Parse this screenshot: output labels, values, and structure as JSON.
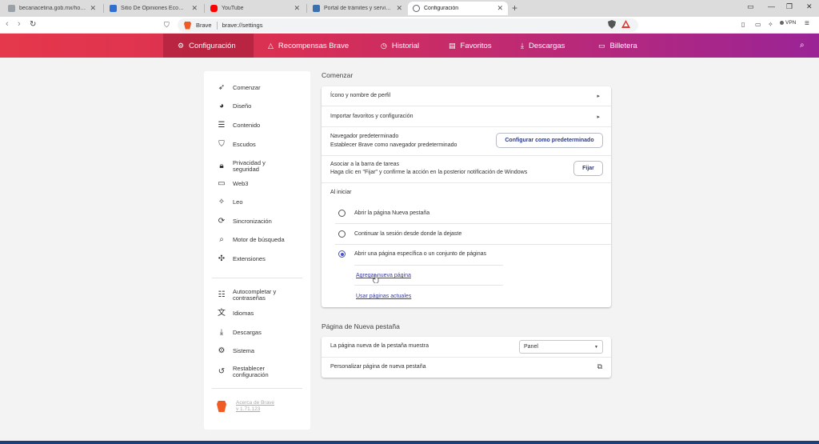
{
  "tabs": [
    {
      "title": "becariacetina.gob.mx/home.shtml",
      "favicon_color": "#9aa0a6",
      "active": false
    },
    {
      "title": "Sitio De Opiniones Ecommerce: Tu",
      "favicon_color": "#2f6fd1",
      "active": false
    },
    {
      "title": "YouTube",
      "favicon_color": "#ff0000",
      "active": false
    },
    {
      "title": "Portal de trámites y servicios - SAT",
      "favicon_color": "#3a6fb0",
      "active": false
    },
    {
      "title": "Configuración",
      "favicon_color": "#5f6368",
      "active": true
    }
  ],
  "new_tab_icon": "plus-icon",
  "address_bar": {
    "brave_label": "Brave",
    "url": "brave://settings"
  },
  "vpn_label": "VPN",
  "header_nav": [
    {
      "label": "Configuración",
      "icon": "gear-icon",
      "active": true
    },
    {
      "label": "Recompensas Brave",
      "icon": "triangle-icon",
      "active": false
    },
    {
      "label": "Historial",
      "icon": "history-icon",
      "active": false
    },
    {
      "label": "Favoritos",
      "icon": "bookmarks-icon",
      "active": false
    },
    {
      "label": "Descargas",
      "icon": "download-icon",
      "active": false
    },
    {
      "label": "Billetera",
      "icon": "wallet-icon",
      "active": false
    }
  ],
  "sidebar": {
    "items": [
      {
        "label": "Comenzar",
        "icon": "rocket-icon"
      },
      {
        "label": "Diseño",
        "icon": "palette-icon"
      },
      {
        "label": "Contenido",
        "icon": "content-icon"
      },
      {
        "label": "Escudos",
        "icon": "shield-icon"
      },
      {
        "label": "Privacidad y seguridad",
        "icon": "lock-icon"
      },
      {
        "label": "Web3",
        "icon": "wallet-icon"
      },
      {
        "label": "Leo",
        "icon": "sparkle-icon"
      },
      {
        "label": "Sincronización",
        "icon": "sync-icon"
      },
      {
        "label": "Motor de búsqueda",
        "icon": "search-icon"
      },
      {
        "label": "Extensiones",
        "icon": "puzzle-icon"
      },
      {
        "label": "Autocompletar y contraseñas",
        "icon": "list-icon"
      },
      {
        "label": "Idiomas",
        "icon": "translate-icon"
      },
      {
        "label": "Descargas",
        "icon": "download-icon"
      },
      {
        "label": "Sistema",
        "icon": "settings-icon"
      },
      {
        "label": "Restablecer configuración",
        "icon": "reset-icon"
      }
    ],
    "about_line1": "Acerca de Brave",
    "about_line2": "v 1.71.123"
  },
  "comenzar": {
    "section_title": "Comenzar",
    "profile_row": "Ícono y nombre de perfil",
    "import_row": "Importar favoritos y configuración",
    "default_browser_title": "Navegador predeterminado",
    "default_browser_sub": "Establecer Brave como navegador predeterminado",
    "default_browser_button": "Configurar como predeterminado",
    "taskbar_title": "Asociar a la barra de tareas",
    "taskbar_sub": "Haga clic en \"Fijar\" y confirme la acción en la posterior notificación de Windows",
    "taskbar_button": "Fijar",
    "startup_title": "Al iniciar",
    "startup_options": [
      {
        "label": "Abrir la página Nueva pestaña",
        "selected": false
      },
      {
        "label": "Continuar la sesión desde donde la dejaste",
        "selected": false
      },
      {
        "label": "Abrir una página específica o un conjunto de páginas",
        "selected": true
      }
    ],
    "add_page_link": "Agregar nueva página",
    "use_current_link": "Usar páginas actuales"
  },
  "new_tab": {
    "section_title": "Página de Nueva pestaña",
    "shows_label": "La página nueva de la pestaña muestra",
    "shows_value": "Panel",
    "customize_label": "Personalizar página de nueva pestaña"
  },
  "colors": {
    "header_start": "#e5384c",
    "header_end": "#9a2496",
    "accent": "#4a52c8"
  }
}
